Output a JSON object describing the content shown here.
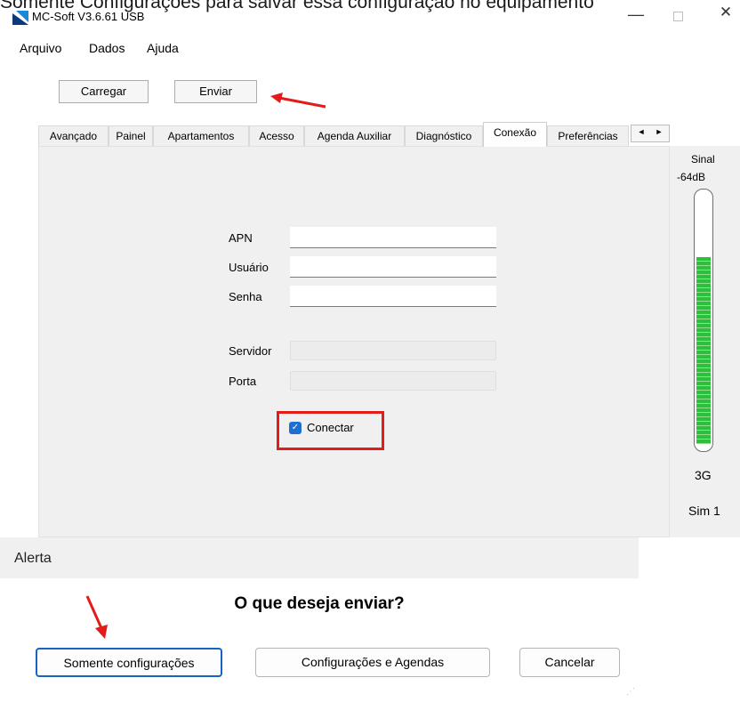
{
  "caption": "Somente Configurações para salvar essa configuração no equipamento",
  "window": {
    "title": "MC-Soft V3.6.61 USB",
    "minimize_glyph": "—",
    "close_glyph": "✕"
  },
  "menu": [
    "Arquivo",
    "Dados",
    "Ajuda"
  ],
  "toolbar": {
    "carregar_label": "Carregar",
    "enviar_label": "Enviar"
  },
  "tabs": [
    {
      "label": "Avançado"
    },
    {
      "label": "Painel"
    },
    {
      "label": "Apartamentos"
    },
    {
      "label": "Acesso"
    },
    {
      "label": "Agenda Auxiliar"
    },
    {
      "label": "Diagnóstico"
    },
    {
      "label": "Conexão",
      "active": true
    },
    {
      "label": "Preferências"
    }
  ],
  "tab_scroll": {
    "left": "◄",
    "right": "►"
  },
  "connection_form": {
    "apn": {
      "label": "APN",
      "value": ""
    },
    "usuario": {
      "label": "Usuário",
      "value": ""
    },
    "senha": {
      "label": "Senha",
      "value": ""
    },
    "servidor": {
      "label": "Servidor",
      "value": ""
    },
    "porta": {
      "label": "Porta",
      "value": ""
    },
    "conectar": {
      "label": "Conectar",
      "checked": true,
      "check_glyph": "✓"
    }
  },
  "signal": {
    "label": "Sinal",
    "value": "-64dB",
    "level_fraction": 0.75,
    "network": "3G",
    "sim": "Sim 1",
    "color": "#2fbf3f"
  },
  "alert": {
    "title": "Alerta",
    "question": "O que deseja enviar?",
    "buttons": {
      "somente": "Somente configurações",
      "config_agendas": "Configurações e Agendas",
      "cancelar": "Cancelar"
    }
  },
  "colors": {
    "highlight_red": "#e31b1b",
    "focus_blue": "#1565c0",
    "checkbox_blue": "#1f6fd0"
  }
}
